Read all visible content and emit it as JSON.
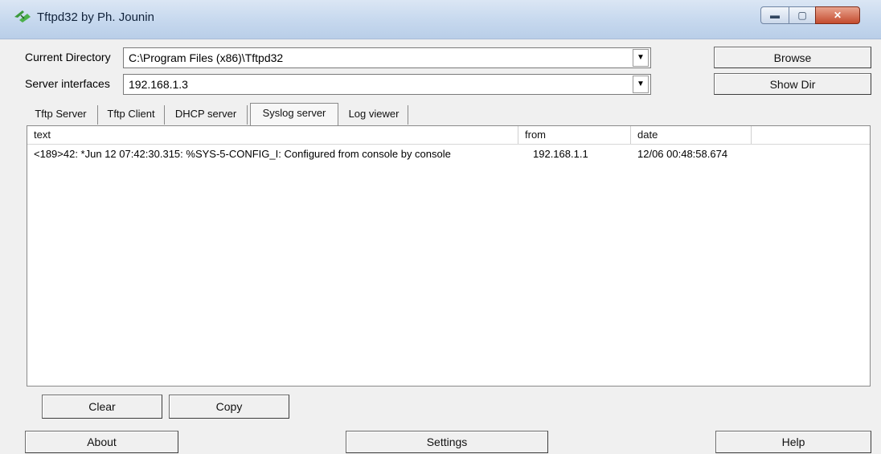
{
  "window": {
    "title": "Tftpd32 by Ph. Jounin"
  },
  "title_buttons": {
    "minimize": "▬",
    "maximize": "▢",
    "close": "✕"
  },
  "current_directory": {
    "label": "Current Directory",
    "value": "C:\\Program Files (x86)\\Tftpd32"
  },
  "server_interfaces": {
    "label": "Server interfaces",
    "value": "192.168.1.3"
  },
  "buttons": {
    "browse": "Browse",
    "show_dir": "Show Dir",
    "clear": "Clear",
    "copy": "Copy",
    "about": "About",
    "settings": "Settings",
    "help": "Help"
  },
  "tabs": [
    {
      "label": "Tftp Server"
    },
    {
      "label": "Tftp Client"
    },
    {
      "label": "DHCP server"
    },
    {
      "label": "Syslog server",
      "active": true
    },
    {
      "label": "Log viewer"
    }
  ],
  "syslog_table": {
    "columns": [
      "text",
      "from",
      "date"
    ],
    "rows": [
      {
        "text": "<189>42: *Jun 12 07:42:30.315: %SYS-5-CONFIG_I: Configured from console by console",
        "from": "192.168.1.1",
        "date": "12/06 00:48:58.674"
      }
    ]
  },
  "colors": {
    "titlebar": "#c6d8ee",
    "close_button": "#c44b2e",
    "window_bg": "#f0f0f0"
  }
}
